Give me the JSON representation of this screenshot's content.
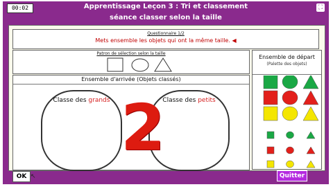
{
  "header": {
    "timer": "00:02",
    "title": "Apprentissage Leçon 3 : Tri et classement",
    "subtitle": "séance classer selon la taille",
    "expand_icon": "expand-icon"
  },
  "question": {
    "label": "Questionnaire 1/2",
    "text": "Mets ensemble les objets qui ont la même taille. ◀"
  },
  "pattern": {
    "label": "Patron de sélection selon la taille",
    "shapes": [
      "square",
      "circle",
      "triangle"
    ]
  },
  "arrivee": {
    "label": "Ensemble d'arrivée (Objets classés)",
    "class_big_prefix": "Classe des ",
    "class_big_word": "grands",
    "class_small_prefix": "Classe des ",
    "class_small_word": "petits",
    "overlay_number": "2"
  },
  "depart": {
    "title": "Ensemble de départ",
    "subtitle": "(Palette des objets)",
    "colors": {
      "green": "#1aa845",
      "red": "#e3201b",
      "yellow": "#f4e600"
    },
    "rows": [
      {
        "size": "large",
        "colors": [
          "green",
          "green",
          "green"
        ]
      },
      {
        "size": "large",
        "colors": [
          "red",
          "red",
          "red"
        ]
      },
      {
        "size": "large",
        "colors": [
          "yellow",
          "yellow",
          "yellow"
        ]
      },
      {
        "size": "small",
        "colors": [
          "green",
          "green",
          "green"
        ]
      },
      {
        "size": "small",
        "colors": [
          "red",
          "red",
          "red"
        ]
      },
      {
        "size": "small",
        "colors": [
          "yellow",
          "yellow",
          "yellow"
        ]
      }
    ]
  },
  "buttons": {
    "ok": "OK",
    "quit": "Quitter"
  }
}
